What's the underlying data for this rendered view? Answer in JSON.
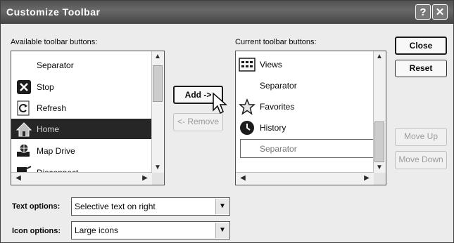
{
  "window": {
    "title": "Customize Toolbar",
    "help_glyph": "?",
    "close_glyph": "✕"
  },
  "available": {
    "label": "Available toolbar buttons:",
    "items": [
      {
        "label": "Separator",
        "icon": "none"
      },
      {
        "label": "Stop",
        "icon": "stop-icon"
      },
      {
        "label": "Refresh",
        "icon": "refresh-icon"
      },
      {
        "label": "Home",
        "icon": "home-icon",
        "selected": true
      },
      {
        "label": "Map Drive",
        "icon": "map-drive-icon"
      },
      {
        "label": "Disconnect",
        "icon": "disconnect-icon"
      }
    ]
  },
  "current": {
    "label": "Current toolbar buttons:",
    "items": [
      {
        "label": "Views",
        "icon": "views-icon"
      },
      {
        "label": "Separator",
        "icon": "none"
      },
      {
        "label": "Favorites",
        "icon": "favorites-icon"
      },
      {
        "label": "History",
        "icon": "history-icon"
      },
      {
        "label": "Separator",
        "icon": "none",
        "focused": true
      }
    ]
  },
  "buttons": {
    "add": "Add ->",
    "remove": "<- Remove",
    "close": "Close",
    "reset": "Reset",
    "move_up": "Move Up",
    "move_down": "Move Down"
  },
  "options": {
    "text_label": "Text options:",
    "text_value": "Selective text on right",
    "icon_label": "Icon options:",
    "icon_value": "Large icons"
  },
  "scroll_glyphs": {
    "up": "▲",
    "down": "▼",
    "left": "◀",
    "right": "▶"
  }
}
